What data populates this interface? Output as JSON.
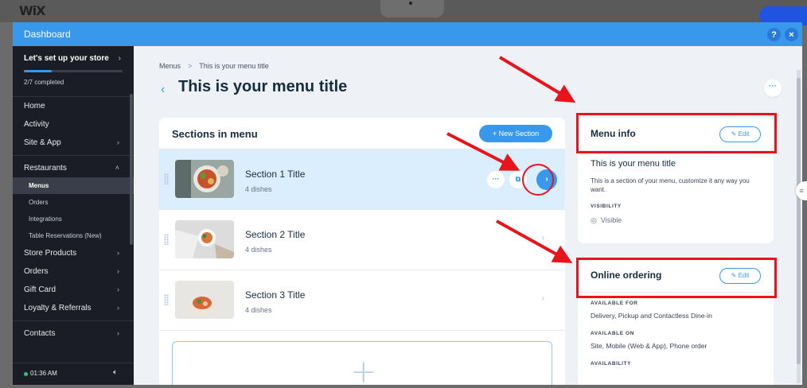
{
  "window": {
    "title": "Dashboard",
    "help_icon": "?",
    "close_icon": "×"
  },
  "editor": {
    "logo": "WiX"
  },
  "sidebar": {
    "setup": {
      "title": "Let's set up your store",
      "progress_text": "2/7 completed",
      "progress_value": 0.2857
    },
    "items": [
      {
        "label": "Home",
        "chevron": false
      },
      {
        "label": "Activity",
        "chevron": false
      },
      {
        "label": "Site & App",
        "chevron": true
      },
      {
        "label": "Restaurants",
        "chevron": true,
        "expanded": true
      },
      {
        "label": "Menus",
        "sub": true,
        "active": true
      },
      {
        "label": "Orders",
        "sub": true
      },
      {
        "label": "Integrations",
        "sub": true
      },
      {
        "label": "Table Reservations (New)",
        "sub": true
      },
      {
        "label": "Store Products",
        "chevron": true
      },
      {
        "label": "Orders",
        "chevron": true
      },
      {
        "label": "Gift Card",
        "chevron": true
      },
      {
        "label": "Loyalty & Referrals",
        "chevron": true
      },
      {
        "label": "Contacts",
        "chevron": true
      }
    ],
    "footer": {
      "time": "01:36 AM",
      "speaker_icon": "speaker-icon"
    }
  },
  "main": {
    "breadcrumb": {
      "root": "Menus",
      "separator": ">",
      "current": "This is your menu title"
    },
    "back_icon": "‹",
    "page_title": "This is your menu title",
    "more_label": "···",
    "sections": {
      "title": "Sections in menu",
      "new_section_label": "+ New Section",
      "rows": [
        {
          "title": "Section 1 Title",
          "subtitle": "4 dishes",
          "selected": true
        },
        {
          "title": "Section 2 Title",
          "subtitle": "4 dishes",
          "selected": false
        },
        {
          "title": "Section 3 Title",
          "subtitle": "4 dishes",
          "selected": false
        }
      ],
      "add_label": "+"
    },
    "menu_info": {
      "title": "Menu info",
      "edit_label": "✎ Edit",
      "name": "This is your menu title",
      "description": "This is a section of your menu, customize it any way you want.",
      "visibility_label": "VISIBILITY",
      "visibility_value": "Visible"
    },
    "online_ordering": {
      "title": "Online ordering",
      "edit_label": "✎ Edit",
      "available_for_label": "AVAILABLE FOR",
      "available_for_value": "Delivery, Pickup and Contactless Dine-in",
      "available_on_label": "AVAILABLE ON",
      "available_on_value": "Site, Mobile (Web & App), Phone order",
      "availability_label": "AVAILABILITY"
    }
  },
  "colors": {
    "accent": "#3899ec",
    "sidebar_bg": "#1a1d26",
    "annotation_red": "#e8141b",
    "selected_row": "#dbeefd"
  }
}
